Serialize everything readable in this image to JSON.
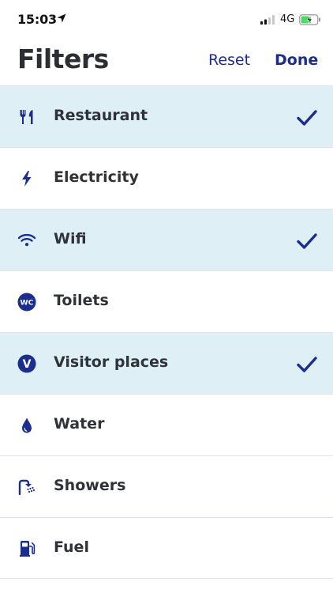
{
  "status_bar": {
    "time": "15:03",
    "network": "4G"
  },
  "header": {
    "title": "Filters",
    "reset_label": "Reset",
    "done_label": "Done"
  },
  "colors": {
    "accent": "#1b2d8f",
    "selected_row_background": "#def0f5",
    "title_text": "#2b2e33",
    "battery_fill": "#4cd964"
  },
  "filters": [
    {
      "label": "Restaurant",
      "icon": "fork-knife-icon",
      "selected": true
    },
    {
      "label": "Electricity",
      "icon": "lightning-bolt-icon",
      "selected": false
    },
    {
      "label": "Wifi",
      "icon": "wifi-icon",
      "selected": true
    },
    {
      "label": "Toilets",
      "icon": "wc-icon",
      "selected": false
    },
    {
      "label": "Visitor places",
      "icon": "visitor-places-icon",
      "selected": true
    },
    {
      "label": "Water",
      "icon": "water-drop-icon",
      "selected": false
    },
    {
      "label": "Showers",
      "icon": "shower-icon",
      "selected": false
    },
    {
      "label": "Fuel",
      "icon": "fuel-pump-icon",
      "selected": false
    }
  ]
}
